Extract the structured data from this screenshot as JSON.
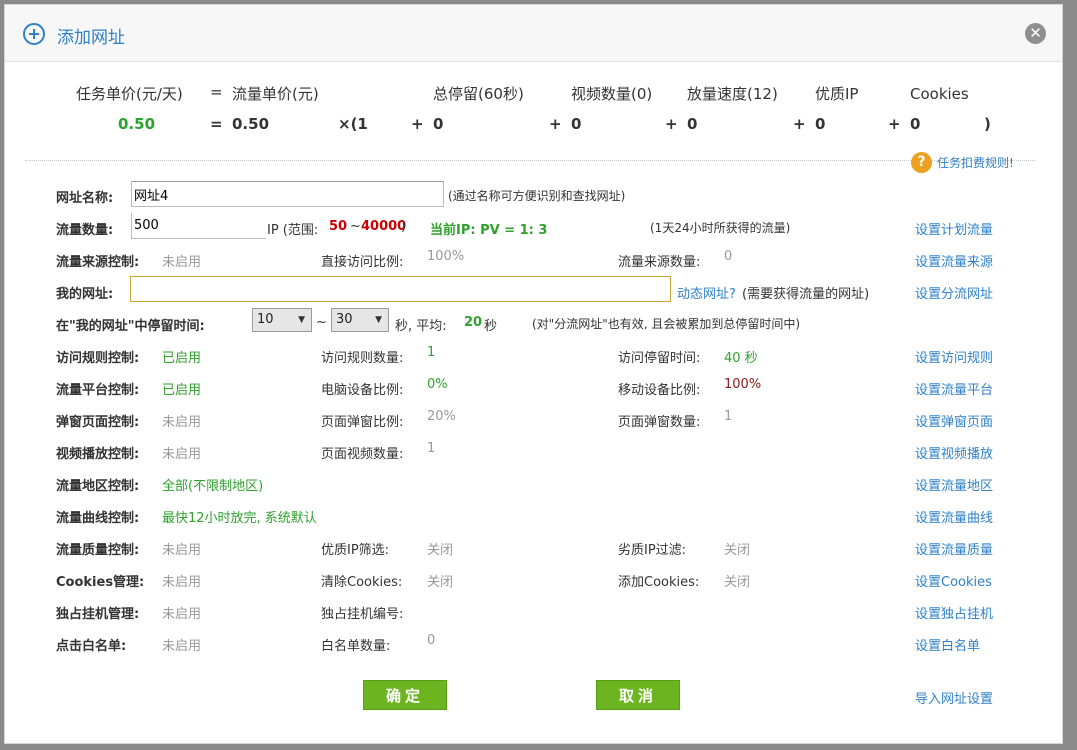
{
  "dialog": {
    "title": "添加网址",
    "close_glyph": "✕"
  },
  "formula": {
    "headers": [
      "任务单价(元/天)",
      "=",
      "流量单价(元)",
      "总停留(60秒)",
      "视频数量(0)",
      "放量速度(12)",
      "优质IP",
      "Cookies"
    ],
    "values": {
      "task_price": "0.50",
      "eq": "=",
      "flow_price": "0.50",
      "times_open": "×(1",
      "plus1": "+",
      "v1": "0",
      "plus2": "+",
      "v2": "0",
      "plus3": "+",
      "v3": "0",
      "plus4": "+",
      "v4": "0",
      "plus5": "+",
      "v5": "0",
      "close": ")"
    }
  },
  "help": {
    "glyph": "?",
    "label": "任务扣费规则!"
  },
  "rows": {
    "name": {
      "label": "网址名称:",
      "value": "网址4",
      "hint": "(通过名称可方便识别和查找网址)"
    },
    "count": {
      "label": "流量数量:",
      "value": "500",
      "ip_prefix": "IP (范围:",
      "min": "50",
      "tilde": "~",
      "max": "40000",
      "close": ")",
      "current": "当前IP: PV = 1: 3",
      "hint": "(1天24小时所获得的流量)",
      "link": "设置计划流量"
    },
    "source": {
      "label": "流量来源控制:",
      "status": "未启用",
      "k1": "直接访问比例:",
      "v1": "100%",
      "k2": "流量来源数量:",
      "v2": "0",
      "link": "设置流量来源"
    },
    "myurl": {
      "label": "我的网址:",
      "value": "",
      "dynamic": "动态网址?",
      "hint": "(需要获得流量的网址)",
      "link": "设置分流网址"
    },
    "stay": {
      "label": "在\"我的网址\"中停留时间:",
      "min": "10",
      "tilde": "~",
      "max": "30",
      "avg_prefix": "秒, 平均:",
      "avg": "20",
      "avg_suffix": "秒",
      "hint": "(对\"分流网址\"也有效, 且会被累加到总停留时间中)"
    },
    "visit": {
      "label": "访问规则控制:",
      "status": "已启用",
      "k1": "访问规则数量:",
      "v1": "1",
      "k2": "访问停留时间:",
      "v2": "40 秒",
      "link": "设置访问规则"
    },
    "platform": {
      "label": "流量平台控制:",
      "status": "已启用",
      "k1": "电脑设备比例:",
      "v1": "0%",
      "k2": "移动设备比例:",
      "v2": "100%",
      "link": "设置流量平台"
    },
    "popup": {
      "label": "弹窗页面控制:",
      "status": "未启用",
      "k1": "页面弹窗比例:",
      "v1": "20%",
      "k2": "页面弹窗数量:",
      "v2": "1",
      "link": "设置弹窗页面"
    },
    "video": {
      "label": "视频播放控制:",
      "status": "未启用",
      "k1": "页面视频数量:",
      "v1": "1",
      "link": "设置视频播放"
    },
    "region": {
      "label": "流量地区控制:",
      "status": "全部(不限制地区)",
      "link": "设置流量地区"
    },
    "curve": {
      "label": "流量曲线控制:",
      "status": "最快12小时放完, 系统默认",
      "link": "设置流量曲线"
    },
    "quality": {
      "label": "流量质量控制:",
      "status": "未启用",
      "k1": "优质IP筛选:",
      "v1": "关闭",
      "k2": "劣质IP过滤:",
      "v2": "关闭",
      "link": "设置流量质量"
    },
    "cookies": {
      "label": "Cookies管理:",
      "status": "未启用",
      "k1": "清除Cookies:",
      "v1": "关闭",
      "k2": "添加Cookies:",
      "v2": "关闭",
      "link": "设置Cookies"
    },
    "exclusive": {
      "label": "独占挂机管理:",
      "status": "未启用",
      "k1": "独占挂机编号:",
      "link": "设置独占挂机"
    },
    "whitelist": {
      "label": "点击白名单:",
      "status": "未启用",
      "k1": "白名单数量:",
      "v1": "0",
      "link": "设置白名单"
    }
  },
  "buttons": {
    "ok": "确定",
    "cancel": "取消",
    "import": "导入网址设置"
  },
  "colors": {
    "accent": "#2f80c8",
    "green": "#2fa12f",
    "button": "#6cb520"
  }
}
